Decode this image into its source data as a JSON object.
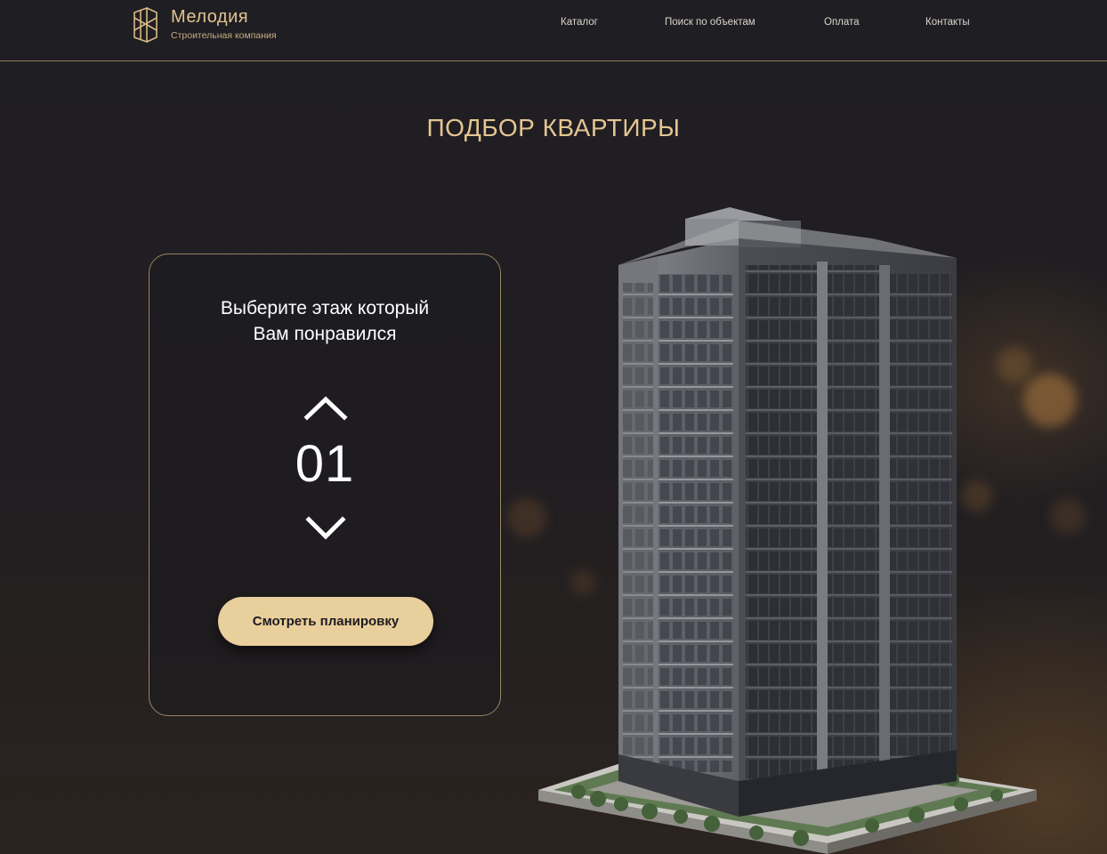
{
  "brand": {
    "name": "Мелодия",
    "tagline": "Строительная компания",
    "accent_color": "#e1c392"
  },
  "nav": {
    "items": [
      "Каталог",
      "Поиск по объектам",
      "Оплата",
      "Контакты"
    ]
  },
  "page": {
    "title": "ПОДБОР КВАРТИРЫ"
  },
  "floor_picker": {
    "prompt_line1": "Выберите этаж который",
    "prompt_line2": "Вам понравился",
    "floor_value": "01",
    "up_icon": "chevron-up-icon",
    "down_icon": "chevron-down-icon",
    "button_label": "Смотреть планировку",
    "button_color": "#e9cf9c"
  },
  "image": {
    "subject": "building-render"
  }
}
